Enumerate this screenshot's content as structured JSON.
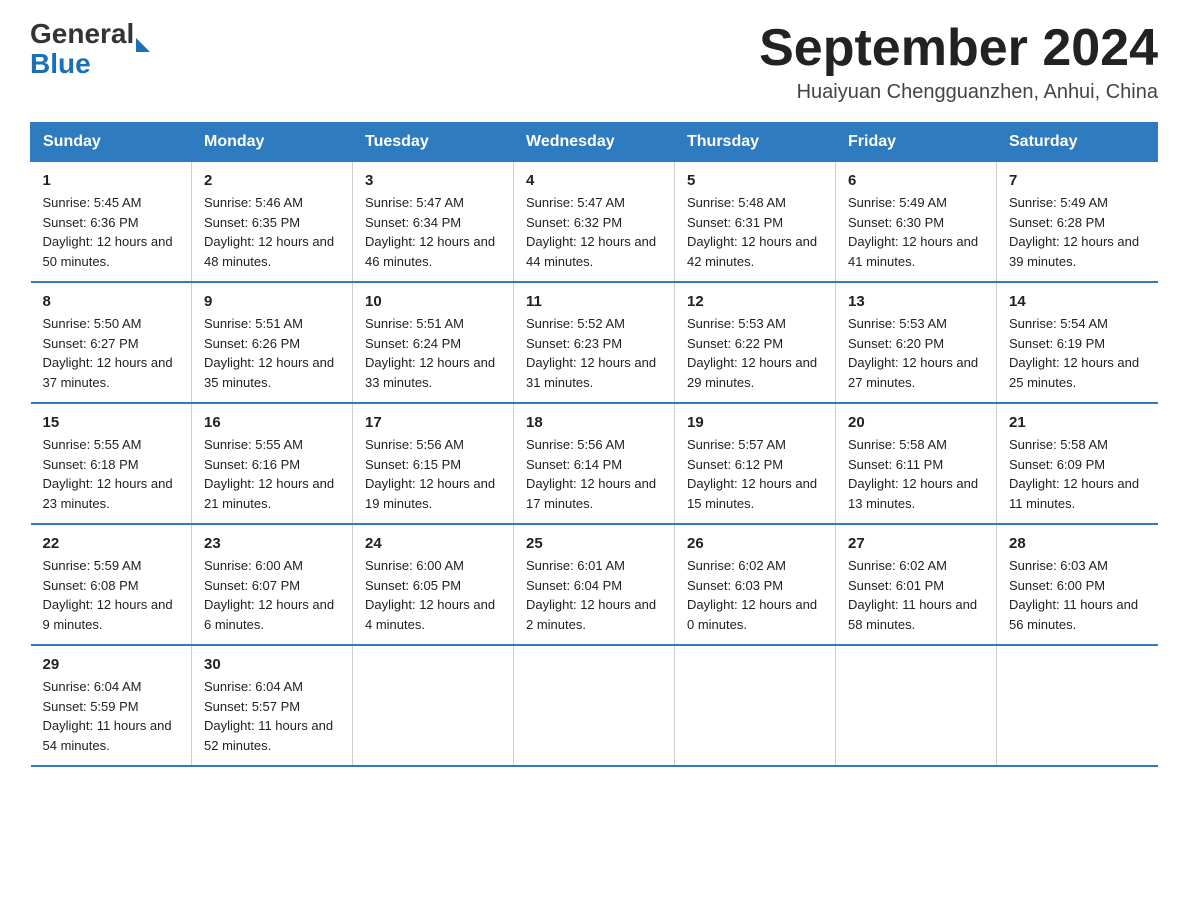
{
  "header": {
    "logo_general": "General",
    "logo_blue": "Blue",
    "title": "September 2024",
    "location": "Huaiyuan Chengguanzhen, Anhui, China"
  },
  "days_of_week": [
    "Sunday",
    "Monday",
    "Tuesday",
    "Wednesday",
    "Thursday",
    "Friday",
    "Saturday"
  ],
  "weeks": [
    [
      {
        "day": "1",
        "sunrise": "5:45 AM",
        "sunset": "6:36 PM",
        "daylight": "12 hours and 50 minutes."
      },
      {
        "day": "2",
        "sunrise": "5:46 AM",
        "sunset": "6:35 PM",
        "daylight": "12 hours and 48 minutes."
      },
      {
        "day": "3",
        "sunrise": "5:47 AM",
        "sunset": "6:34 PM",
        "daylight": "12 hours and 46 minutes."
      },
      {
        "day": "4",
        "sunrise": "5:47 AM",
        "sunset": "6:32 PM",
        "daylight": "12 hours and 44 minutes."
      },
      {
        "day": "5",
        "sunrise": "5:48 AM",
        "sunset": "6:31 PM",
        "daylight": "12 hours and 42 minutes."
      },
      {
        "day": "6",
        "sunrise": "5:49 AM",
        "sunset": "6:30 PM",
        "daylight": "12 hours and 41 minutes."
      },
      {
        "day": "7",
        "sunrise": "5:49 AM",
        "sunset": "6:28 PM",
        "daylight": "12 hours and 39 minutes."
      }
    ],
    [
      {
        "day": "8",
        "sunrise": "5:50 AM",
        "sunset": "6:27 PM",
        "daylight": "12 hours and 37 minutes."
      },
      {
        "day": "9",
        "sunrise": "5:51 AM",
        "sunset": "6:26 PM",
        "daylight": "12 hours and 35 minutes."
      },
      {
        "day": "10",
        "sunrise": "5:51 AM",
        "sunset": "6:24 PM",
        "daylight": "12 hours and 33 minutes."
      },
      {
        "day": "11",
        "sunrise": "5:52 AM",
        "sunset": "6:23 PM",
        "daylight": "12 hours and 31 minutes."
      },
      {
        "day": "12",
        "sunrise": "5:53 AM",
        "sunset": "6:22 PM",
        "daylight": "12 hours and 29 minutes."
      },
      {
        "day": "13",
        "sunrise": "5:53 AM",
        "sunset": "6:20 PM",
        "daylight": "12 hours and 27 minutes."
      },
      {
        "day": "14",
        "sunrise": "5:54 AM",
        "sunset": "6:19 PM",
        "daylight": "12 hours and 25 minutes."
      }
    ],
    [
      {
        "day": "15",
        "sunrise": "5:55 AM",
        "sunset": "6:18 PM",
        "daylight": "12 hours and 23 minutes."
      },
      {
        "day": "16",
        "sunrise": "5:55 AM",
        "sunset": "6:16 PM",
        "daylight": "12 hours and 21 minutes."
      },
      {
        "day": "17",
        "sunrise": "5:56 AM",
        "sunset": "6:15 PM",
        "daylight": "12 hours and 19 minutes."
      },
      {
        "day": "18",
        "sunrise": "5:56 AM",
        "sunset": "6:14 PM",
        "daylight": "12 hours and 17 minutes."
      },
      {
        "day": "19",
        "sunrise": "5:57 AM",
        "sunset": "6:12 PM",
        "daylight": "12 hours and 15 minutes."
      },
      {
        "day": "20",
        "sunrise": "5:58 AM",
        "sunset": "6:11 PM",
        "daylight": "12 hours and 13 minutes."
      },
      {
        "day": "21",
        "sunrise": "5:58 AM",
        "sunset": "6:09 PM",
        "daylight": "12 hours and 11 minutes."
      }
    ],
    [
      {
        "day": "22",
        "sunrise": "5:59 AM",
        "sunset": "6:08 PM",
        "daylight": "12 hours and 9 minutes."
      },
      {
        "day": "23",
        "sunrise": "6:00 AM",
        "sunset": "6:07 PM",
        "daylight": "12 hours and 6 minutes."
      },
      {
        "day": "24",
        "sunrise": "6:00 AM",
        "sunset": "6:05 PM",
        "daylight": "12 hours and 4 minutes."
      },
      {
        "day": "25",
        "sunrise": "6:01 AM",
        "sunset": "6:04 PM",
        "daylight": "12 hours and 2 minutes."
      },
      {
        "day": "26",
        "sunrise": "6:02 AM",
        "sunset": "6:03 PM",
        "daylight": "12 hours and 0 minutes."
      },
      {
        "day": "27",
        "sunrise": "6:02 AM",
        "sunset": "6:01 PM",
        "daylight": "11 hours and 58 minutes."
      },
      {
        "day": "28",
        "sunrise": "6:03 AM",
        "sunset": "6:00 PM",
        "daylight": "11 hours and 56 minutes."
      }
    ],
    [
      {
        "day": "29",
        "sunrise": "6:04 AM",
        "sunset": "5:59 PM",
        "daylight": "11 hours and 54 minutes."
      },
      {
        "day": "30",
        "sunrise": "6:04 AM",
        "sunset": "5:57 PM",
        "daylight": "11 hours and 52 minutes."
      },
      null,
      null,
      null,
      null,
      null
    ]
  ],
  "labels": {
    "sunrise": "Sunrise:",
    "sunset": "Sunset:",
    "daylight": "Daylight:"
  }
}
